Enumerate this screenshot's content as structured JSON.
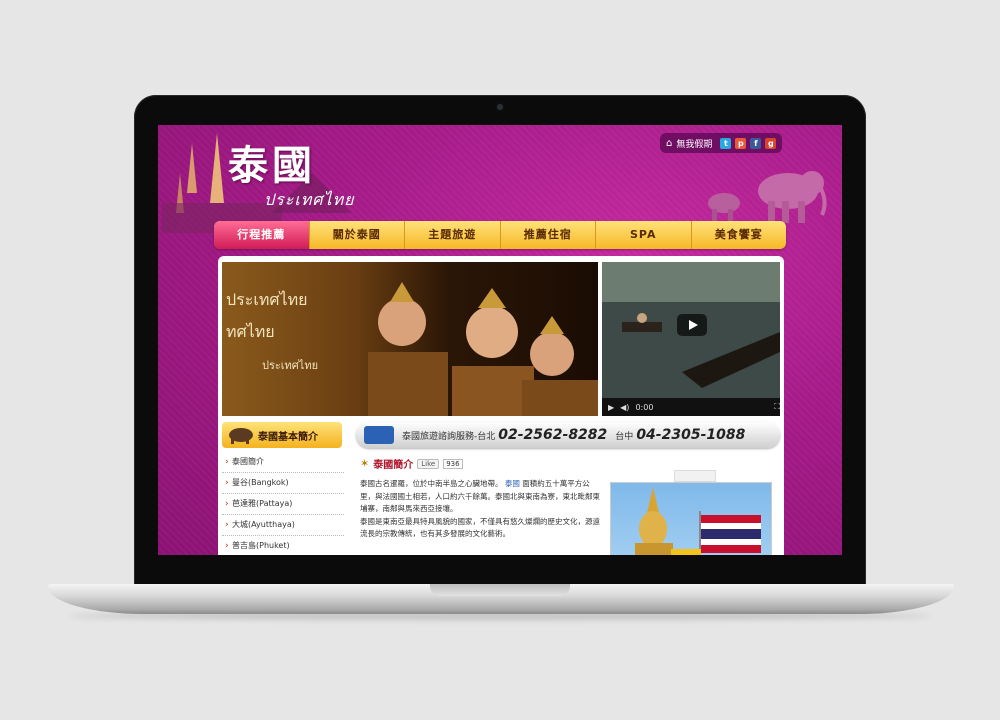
{
  "site": {
    "title": "泰國",
    "subtitle": "ประเทศไทย"
  },
  "toplinks": {
    "label": "無我假期",
    "social": [
      "twitter",
      "plurk",
      "facebook",
      "google"
    ]
  },
  "nav": {
    "items": [
      {
        "label": "行程推薦",
        "active": true
      },
      {
        "label": "關於泰國",
        "active": false
      },
      {
        "label": "主題旅遊",
        "active": false
      },
      {
        "label": "推薦住宿",
        "active": false
      },
      {
        "label": "SPA",
        "active": false
      },
      {
        "label": "美食饗宴",
        "active": false
      }
    ]
  },
  "banner": {
    "thai_lines": [
      "ประเทศไทย",
      "ทศไทย",
      "ประเทศไทย"
    ]
  },
  "video": {
    "time": "0:00"
  },
  "sidebar": {
    "heading": "泰國基本簡介",
    "items": [
      "泰國簡介",
      "曼谷(Bangkok)",
      "芭達雅(Pattaya)",
      "大城(Ayutthaya)",
      "普吉島(Phuket)"
    ]
  },
  "contact": {
    "label": "泰國旅遊諮詢服務-台北",
    "taipei": "02-2562-8282",
    "taichung_label": "台中",
    "taichung": "04-2305-1088"
  },
  "intro": {
    "heading": "泰國簡介",
    "like_label": "Like",
    "like_count": "936",
    "p1": "泰國古名暹羅，位於中南半島之心臟地帶。",
    "p1_hl": "泰國",
    "p1_rest": "面積約五十萬平方公里，與法國國土相若，人口約六千餘萬。泰國北與東南為寮，東北毗鄰柬埔寨，南鄰與馬來西亞接壤。",
    "p2": "泰國是東南亞最具特具風貌的國家，不僅具有悠久燦爛的歷史文化，源遠流長的宗教傳統，也有其多發展的文化藝術。"
  },
  "colors": {
    "background": "#a41a87",
    "nav": "#f6b826",
    "nav_active": "#d11c56"
  }
}
